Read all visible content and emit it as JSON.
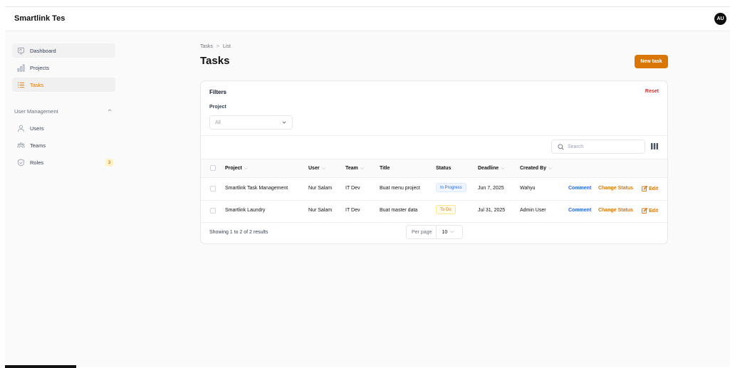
{
  "app": {
    "title": "Smartlink Tes",
    "avatar_initials": "AU",
    "accent_color": "#d97706"
  },
  "sidebar": {
    "items": [
      {
        "label": "Dashboard",
        "icon": "dashboard-icon"
      },
      {
        "label": "Projects",
        "icon": "chart-icon"
      },
      {
        "label": "Tasks",
        "icon": "list-icon",
        "active": true
      }
    ],
    "group_label": "User Management",
    "group_items": [
      {
        "label": "Users",
        "icon": "user-icon"
      },
      {
        "label": "Teams",
        "icon": "team-icon"
      },
      {
        "label": "Roles",
        "icon": "shield-icon",
        "badge": "3"
      }
    ]
  },
  "breadcrumb": {
    "parent": "Tasks",
    "separator": ">",
    "current": "List"
  },
  "page": {
    "title": "Tasks",
    "new_button": "New task"
  },
  "filters": {
    "title": "Filters",
    "reset": "Reset",
    "project_label": "Project",
    "project_value": "All"
  },
  "search": {
    "placeholder": "Search"
  },
  "table": {
    "headers": {
      "project": "Project",
      "user": "User",
      "team": "Team",
      "title": "Title",
      "status": "Status",
      "deadline": "Deadline",
      "created_by": "Created By"
    },
    "rows": [
      {
        "project": "Smartlink Task Management",
        "user": "Nur Salam",
        "team": "IT Dev",
        "title": "Buat menu project",
        "status": "In Progress",
        "deadline": "Jun 7, 2025",
        "created_by": "Wahyu"
      },
      {
        "project": "Smartlink Laundry",
        "user": "Nur Salam",
        "team": "IT Dev",
        "title": "Buat master data",
        "status": "To Do",
        "deadline": "Jul 31, 2025",
        "created_by": "Admin User"
      }
    ],
    "actions": {
      "comment": "Comment",
      "change_status": "Change Status",
      "edit": "Edit"
    }
  },
  "pagination": {
    "summary": "Showing 1 to 2 of 2 results",
    "per_page_label": "Per page",
    "per_page_value": "10"
  }
}
